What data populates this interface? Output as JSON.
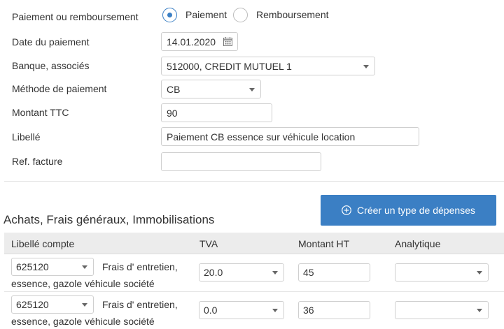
{
  "form": {
    "type_label": "Paiement ou remboursement",
    "radio_payment": "Paiement",
    "radio_refund": "Remboursement",
    "selected": "payment",
    "date_label": "Date du paiement",
    "date_value": "14.01.2020",
    "bank_label": "Banque, associés",
    "bank_value": "512000, CREDIT MUTUEL 1",
    "method_label": "Méthode de paiement",
    "method_value": "CB",
    "amount_label": "Montant TTC",
    "amount_value": "90",
    "description_label": "Libellé",
    "description_value": "Paiement CB essence sur véhicule location",
    "invoice_ref_label": "Ref. facture",
    "invoice_ref_value": ""
  },
  "expenses": {
    "section_title": "Achats, Frais généraux, Immobilisations",
    "create_button": "Créer un type de dépenses",
    "columns": [
      "Libellé compte",
      "TVA",
      "Montant HT",
      "Analytique"
    ],
    "rows": [
      {
        "account": "625120",
        "desc_line1": "Frais d' entretien,",
        "desc_line2": "essence, gazole véhicule société",
        "vat": "20.0",
        "amount_ht": "45",
        "analytic": ""
      },
      {
        "account": "625120",
        "desc_line1": "Frais d' entretien,",
        "desc_line2": "essence, gazole véhicule société",
        "vat": "0.0",
        "amount_ht": "36",
        "analytic": ""
      }
    ]
  },
  "colors": {
    "accent": "#3b7fc4",
    "header_bg": "#ececec"
  }
}
